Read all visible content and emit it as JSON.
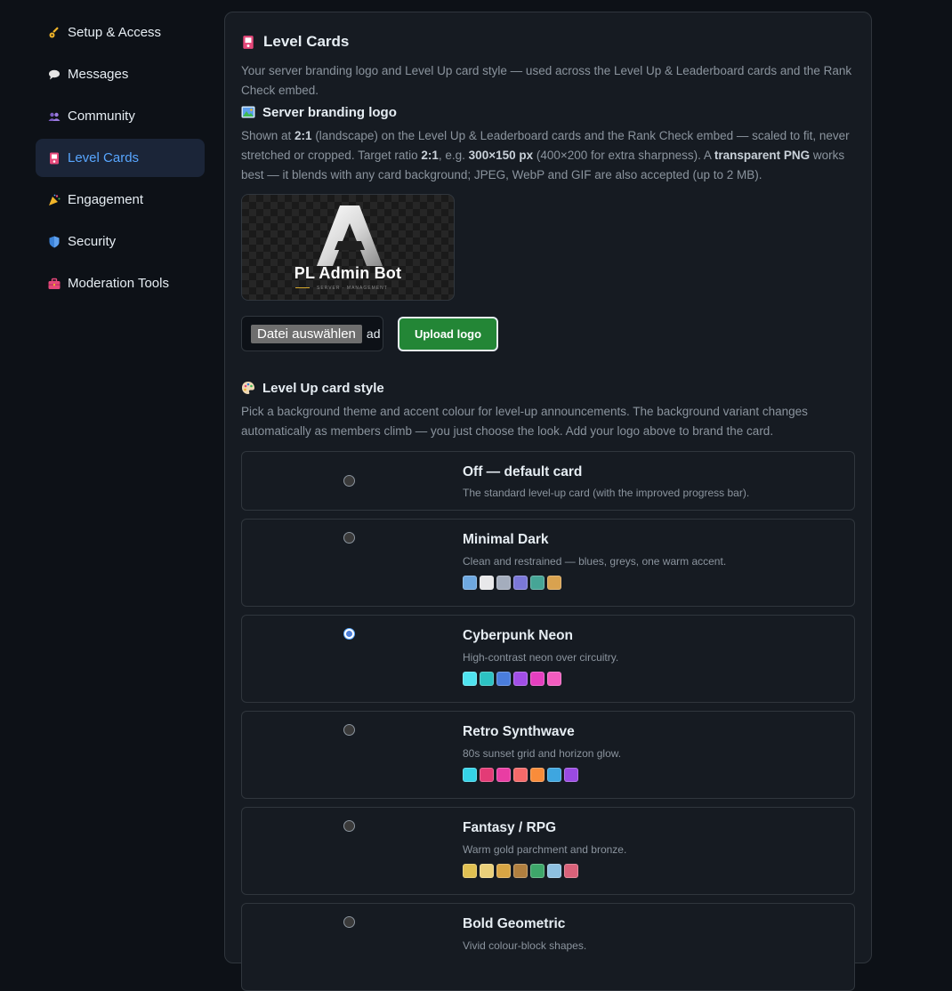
{
  "sidebar": {
    "items": [
      {
        "label": "Setup & Access",
        "icon": "key-icon",
        "active": false
      },
      {
        "label": "Messages",
        "icon": "speech-bubble-icon",
        "active": false
      },
      {
        "label": "Community",
        "icon": "people-icon",
        "active": false
      },
      {
        "label": "Level Cards",
        "icon": "card-icon",
        "active": true
      },
      {
        "label": "Engagement",
        "icon": "party-popper-icon",
        "active": false
      },
      {
        "label": "Security",
        "icon": "shield-icon",
        "active": false
      },
      {
        "label": "Moderation Tools",
        "icon": "toolbox-icon",
        "active": false
      }
    ]
  },
  "panel": {
    "title": "Level Cards",
    "intro": "Your server branding logo and Level Up card style — used across the Level Up & Leaderboard cards and the Rank Check embed."
  },
  "branding": {
    "title": "Server branding logo",
    "desc_1": "Shown at ",
    "desc_b1": "2:1",
    "desc_2": " (landscape) on the Level Up & Leaderboard cards and the Rank Check embed — scaled to fit, never stretched or cropped. Target ratio ",
    "desc_b2": "2:1",
    "desc_3": ", e.g. ",
    "desc_b3": "300×150 px",
    "desc_4": " (400×200 for extra sharpness). A ",
    "desc_b4": "transparent PNG",
    "desc_5": " works best — it blends with any card background; JPEG, WebP and GIF are also accepted (up to 2 MB).",
    "logo_text": "PL Admin Bot",
    "logo_sub": "SERVER · MANAGEMENT",
    "file_button": "Datei auswählen",
    "file_status": "ad",
    "upload_label": "Upload logo"
  },
  "card_style": {
    "title": "Level Up card style",
    "desc": "Pick a background theme and accent colour for level-up announcements. The background variant changes automatically as members climb — you just choose the look. Add your logo above to brand the card.",
    "options": [
      {
        "name": "Off — default card",
        "desc": "The standard level-up card (with the improved progress bar).",
        "checked": false,
        "swatches": []
      },
      {
        "name": "Minimal Dark",
        "desc": "Clean and restrained — blues, greys, one warm accent.",
        "checked": false,
        "swatches": [
          "#6ea8e0",
          "#e8e8ea",
          "#a4adbd",
          "#7b78d8",
          "#46a596",
          "#d9a24f"
        ]
      },
      {
        "name": "Cyberpunk Neon",
        "desc": "High-contrast neon over circuitry.",
        "checked": true,
        "swatches": [
          "#4fe3ef",
          "#2cc2c2",
          "#4a7ddc",
          "#a14ee6",
          "#e53fbf",
          "#f25cbf"
        ]
      },
      {
        "name": "Retro Synthwave",
        "desc": "80s sunset grid and horizon glow.",
        "checked": false,
        "swatches": [
          "#35d3e8",
          "#e33b76",
          "#e93da3",
          "#f56a6a",
          "#f98c3a",
          "#3ea6e0",
          "#9a4ae2"
        ]
      },
      {
        "name": "Fantasy / RPG",
        "desc": "Warm gold parchment and bronze.",
        "checked": false,
        "swatches": [
          "#e0c052",
          "#ead07a",
          "#d8a544",
          "#b07f3f",
          "#3ea76a",
          "#8ec0e0",
          "#d9627a"
        ]
      },
      {
        "name": "Bold Geometric",
        "desc": "Vivid colour-block shapes.",
        "checked": false,
        "swatches": []
      }
    ]
  }
}
